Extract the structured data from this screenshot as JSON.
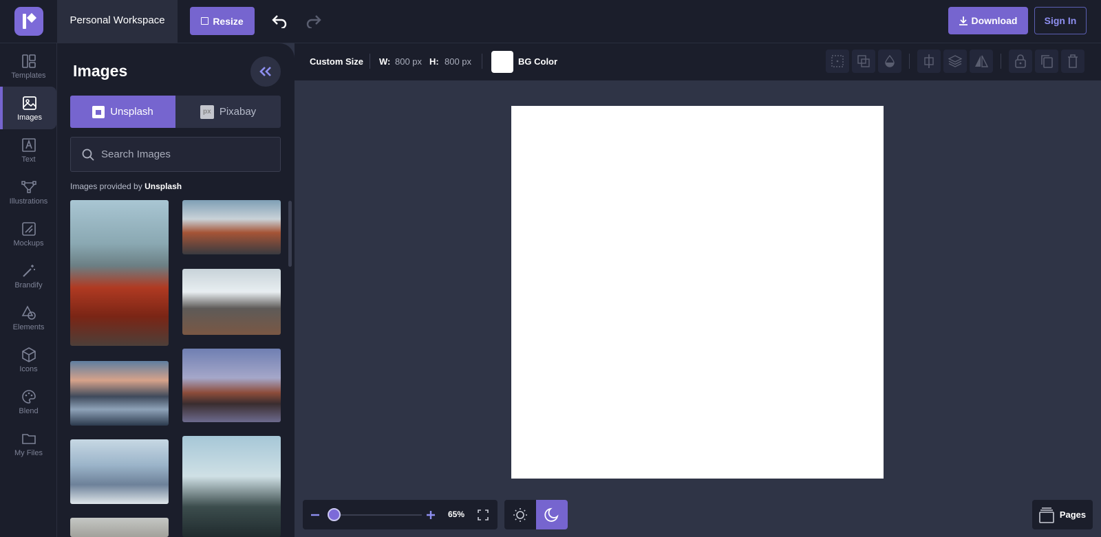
{
  "header": {
    "workspace_name": "Personal Workspace",
    "resize_label": "Resize",
    "download_label": "Download",
    "signin_label": "Sign In"
  },
  "sidebar": {
    "items": [
      {
        "label": "Templates",
        "icon": "templates-icon"
      },
      {
        "label": "Images",
        "icon": "image-icon",
        "active": true
      },
      {
        "label": "Text",
        "icon": "text-icon"
      },
      {
        "label": "Illustrations",
        "icon": "vector-icon"
      },
      {
        "label": "Mockups",
        "icon": "mockup-icon"
      },
      {
        "label": "Brandify",
        "icon": "magic-wand-icon"
      },
      {
        "label": "Elements",
        "icon": "shapes-icon"
      },
      {
        "label": "Icons",
        "icon": "cube-icon"
      },
      {
        "label": "Blend",
        "icon": "palette-icon"
      },
      {
        "label": "My Files",
        "icon": "folder-icon"
      }
    ]
  },
  "panel": {
    "title": "Images",
    "tabs": [
      {
        "label": "Unsplash"
      },
      {
        "label": "Pixabay",
        "icon_text": "px"
      }
    ],
    "search_placeholder": "Search Images",
    "provided_prefix": "Images provided by",
    "provided_source": "Unsplash"
  },
  "props": {
    "size_label": "Custom Size",
    "w_label": "W:",
    "w_value": "800 px",
    "h_label": "H:",
    "h_value": "800 px",
    "bg_label": "BG Color",
    "bg_color": "#ffffff"
  },
  "zoom": {
    "level": "65%"
  },
  "footer": {
    "pages_label": "Pages"
  },
  "colors": {
    "accent": "#7665cf",
    "background": "#2f3446",
    "panel": "#1b1e2b"
  }
}
